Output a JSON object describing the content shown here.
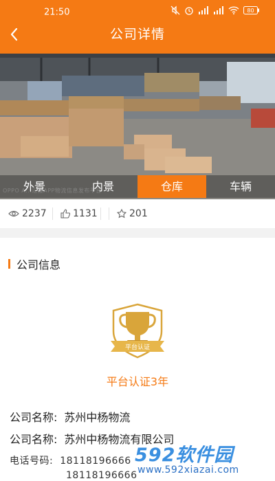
{
  "status_bar": {
    "time": "21:50",
    "battery": "80"
  },
  "header": {
    "title": "公司详情",
    "back_icon": "chevron-left-icon"
  },
  "photo": {
    "watermark": "OPPO A...汇搜APP物流信息发布平台"
  },
  "tabs": [
    {
      "label": "外景",
      "active": false
    },
    {
      "label": "内景",
      "active": false
    },
    {
      "label": "仓库",
      "active": true
    },
    {
      "label": "车辆",
      "active": false
    }
  ],
  "stats": {
    "views": "2237",
    "likes": "1131",
    "favorites": "201"
  },
  "company_info": {
    "section_title": "公司信息",
    "badge_text": "平台认证",
    "certification": "平台认证3年",
    "rows": [
      {
        "key": "公司名称:",
        "value": "苏州中杨物流"
      },
      {
        "key": "公司名称:",
        "value": "苏州中杨物流有限公司"
      }
    ],
    "phone_label": "电话号码:",
    "phones": [
      "18118196666",
      "18118196666"
    ]
  },
  "site_watermark": {
    "name": "592软件园",
    "url": "www.592xiazai.com"
  },
  "colors": {
    "accent": "#f57a14",
    "badge_gold": "#d9a53a",
    "watermark_blue": "#3a8fe0"
  }
}
